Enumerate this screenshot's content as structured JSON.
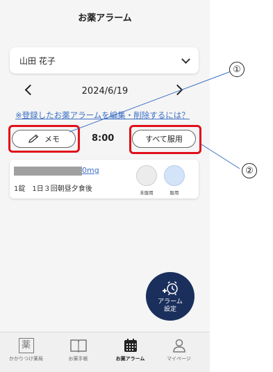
{
  "app": {
    "title": "お薬アラーム"
  },
  "patient": {
    "name": "山田 花子"
  },
  "date": {
    "current": "2024/6/19"
  },
  "help_link": "※登録したお薬アラームを編集・削除するには？",
  "toolbar": {
    "memo_label": "メモ",
    "time": "8:00",
    "take_all_label": "すべて服用"
  },
  "medicine": {
    "name_suffix": "0mg",
    "dosage": "1錠　1日３回朝昼夕食後",
    "not_taken_label": "未服用",
    "taken_label": "服用"
  },
  "fab": {
    "line1": "アラーム",
    "line2": "設定"
  },
  "tabs": [
    {
      "label": "かかりつけ薬局",
      "icon": "pharmacy-icon",
      "glyph": "薬"
    },
    {
      "label": "お薬手帳",
      "icon": "book-icon"
    },
    {
      "label": "お薬アラーム",
      "icon": "calendar-icon",
      "active": true
    },
    {
      "label": "マイページ",
      "icon": "person-icon"
    }
  ],
  "annotations": {
    "callout1": "①",
    "callout2": "②"
  },
  "colors": {
    "accent_blue": "#3a6fc4",
    "fab": "#1a2f5c",
    "highlight_red": "#e0101a"
  }
}
